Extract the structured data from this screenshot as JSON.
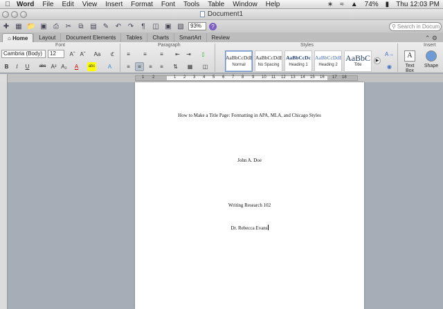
{
  "menubar": {
    "apple": "",
    "items": [
      "Word",
      "File",
      "Edit",
      "View",
      "Insert",
      "Format",
      "Font",
      "Tools",
      "Table",
      "Window",
      "Help"
    ],
    "battery": "74%",
    "clock": "Thu 12:03 PM"
  },
  "window": {
    "title": "Document1"
  },
  "toolbar": {
    "zoom": "93%",
    "search_placeholder": "Search in Docum"
  },
  "ribbon_tabs": [
    "Home",
    "Layout",
    "Document Elements",
    "Tables",
    "Charts",
    "SmartArt",
    "Review"
  ],
  "ribbon": {
    "groups": {
      "font": "Font",
      "paragraph": "Paragraph",
      "styles": "Styles",
      "insert": "Insert"
    },
    "font_name": "Cambria (Body)",
    "font_size": "12",
    "styles": [
      {
        "sample": "AaBbCcDdEe",
        "name": "Normal"
      },
      {
        "sample": "AaBbCcDdEe",
        "name": "No Spacing"
      },
      {
        "sample": "AaBbCcDc",
        "name": "Heading 1"
      },
      {
        "sample": "AaBbCcDdEe",
        "name": "Heading 2"
      },
      {
        "sample": "AaBbC",
        "name": "Title"
      }
    ],
    "insert": {
      "text_box": "Text Box",
      "shape": "Shape"
    },
    "ruler_numbers": [
      "1",
      "2",
      "1",
      "2",
      "3",
      "4",
      "5",
      "6",
      "7",
      "8",
      "9",
      "10",
      "11",
      "12",
      "13",
      "14",
      "15",
      "16",
      "17",
      "18"
    ]
  },
  "document": {
    "title_line": "How to Make a Title Page: Formatting in APA, MLA, and Chicago Styles",
    "author": "John A. Doe",
    "course": "Writing Research 102",
    "instructor": "Dr. Rebecca Evans"
  }
}
